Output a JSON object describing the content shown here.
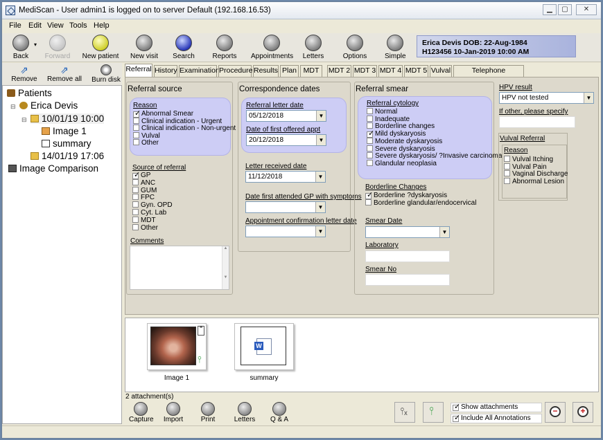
{
  "window": {
    "title": "MediScan - User admin1 is logged on to server Default (192.168.16.53)"
  },
  "menu": [
    "File",
    "Edit",
    "View",
    "Tools",
    "Help"
  ],
  "toolbar": {
    "back": "Back",
    "forward": "Forward",
    "new_patient": "New patient",
    "new_visit": "New visit",
    "search": "Search",
    "reports": "Reports",
    "appointments": "Appointments",
    "letters": "Letters",
    "options": "Options",
    "simple": "Simple"
  },
  "patient": {
    "line1": "Erica Devis   DOB:  22-Aug-1984",
    "line2": "H123456  10-Jan-2019  10:00 AM"
  },
  "left_toolbar": {
    "remove": "Remove",
    "remove_all": "Remove all",
    "burn_disk": "Burn disk"
  },
  "tree": {
    "patients": "Patients",
    "patient": "Erica Devis",
    "visit1": "10/01/19 10:00",
    "image1": "Image 1",
    "summary": "summary",
    "visit2": "14/01/19 17:06",
    "image_comparison": "Image Comparison"
  },
  "tabs": [
    "Referral",
    "History",
    "Examination",
    "Procedure",
    "Results",
    "Plan",
    "MDT",
    "MDT 2",
    "MDT 3",
    "MDT 4",
    "MDT 5",
    "Vulval",
    "Telephone Consultation"
  ],
  "referral_source": {
    "heading": "Referral source",
    "reason_label": "Reason",
    "reasons": [
      {
        "label": "Abnormal Smear",
        "checked": true
      },
      {
        "label": "Clinical indication - Urgent",
        "checked": false
      },
      {
        "label": "Clinical indication - Non-urgent",
        "checked": false
      },
      {
        "label": "Vulval",
        "checked": false
      },
      {
        "label": "Other",
        "checked": false
      }
    ],
    "source_label": "Source of referral",
    "sources": [
      {
        "label": "GP",
        "checked": true
      },
      {
        "label": "ANC",
        "checked": false
      },
      {
        "label": "GUM",
        "checked": false
      },
      {
        "label": "FPC",
        "checked": false
      },
      {
        "label": "Gyn. OPD",
        "checked": false
      },
      {
        "label": "Cyt. Lab",
        "checked": false
      },
      {
        "label": "MDT",
        "checked": false
      },
      {
        "label": "Other",
        "checked": false
      }
    ],
    "comments_label": "Comments"
  },
  "correspondence": {
    "heading": "Correspondence dates",
    "referral_letter_label": "Referral letter date",
    "referral_letter_value": "05/12/2018",
    "first_offered_label": "Date of first offered appt",
    "first_offered_value": "20/12/2018",
    "letter_received_label": "Letter received date",
    "letter_received_value": "11/12/2018",
    "first_attended_label": "Date first attended GP with symptoms",
    "first_attended_value": "",
    "confirmation_label": "Appointment confirmation letter date",
    "confirmation_value": ""
  },
  "smear": {
    "heading": "Referral smear",
    "cytology_label": "Referral cytology",
    "cytology": [
      {
        "label": "Normal",
        "checked": false
      },
      {
        "label": "Inadequate",
        "checked": false
      },
      {
        "label": "Borderline changes",
        "checked": false
      },
      {
        "label": "Mild dyskaryosis",
        "checked": true
      },
      {
        "label": "Moderate dyskaryosis",
        "checked": false
      },
      {
        "label": "Severe dyskaryosis",
        "checked": false
      },
      {
        "label": "Severe dyskaryosis/ ?Invasive carcinoma",
        "checked": false
      },
      {
        "label": "Glandular neoplasia",
        "checked": false
      }
    ],
    "borderline_label": "Borderline Changes",
    "borderline": [
      {
        "label": "Borderline ?dyskaryosis",
        "checked": true
      },
      {
        "label": "Borderline glandular/endocervical",
        "checked": false
      }
    ],
    "smear_date_label": "Smear Date",
    "smear_date_value": "",
    "laboratory_label": "Laboratory",
    "smear_no_label": "Smear No"
  },
  "hpv": {
    "label": "HPV result",
    "value": "HPV not tested",
    "other_label": "If other, please specify"
  },
  "vulval": {
    "heading": "Vulval Referral",
    "reason_label": "Reason",
    "reasons": [
      {
        "label": "Vulval Itching",
        "checked": false
      },
      {
        "label": "Vulval Pain",
        "checked": false
      },
      {
        "label": "Vaginal Discharge",
        "checked": false
      },
      {
        "label": "Abnormal Lesion",
        "checked": false
      }
    ]
  },
  "attachments": {
    "items": [
      {
        "caption": "Image 1"
      },
      {
        "caption": "summary"
      }
    ],
    "count_text": "2 attachment(s)"
  },
  "bottom": {
    "capture": "Capture",
    "import": "Import",
    "print": "Print",
    "letters": "Letters",
    "qa": "Q & A",
    "show_attachments": "Show attachments",
    "show_attachments_checked": true,
    "include_annotations": "Include All Annotations",
    "include_annotations_checked": true
  },
  "colors": {
    "panel_blue": "#cdcdf5",
    "patient_banner": "#a9b3dd"
  }
}
